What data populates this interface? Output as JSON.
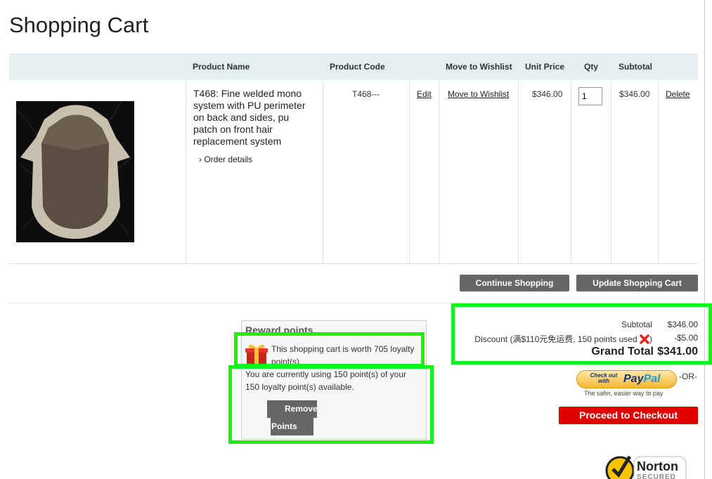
{
  "page": {
    "title": "Shopping Cart"
  },
  "table": {
    "headers": {
      "product_name": "Product Name",
      "product_code": "Product Code",
      "move_to_wishlist": "Move to Wishlist",
      "unit_price": "Unit Price",
      "qty": "Qty",
      "subtotal": "Subtotal"
    },
    "item": {
      "name": "T468: Fine welded mono system with PU perimeter on back and sides, pu patch on front hair replacement system",
      "order_details": "Order details",
      "code": "T468---",
      "edit": "Edit",
      "move_to_wishlist": "Move to Wishlist",
      "unit_price": "$346.00",
      "qty": "1",
      "subtotal": "$346.00",
      "delete": "Delete"
    }
  },
  "actions": {
    "continue_shopping": "Continue Shopping",
    "update_cart": "Update Shopping Cart"
  },
  "reward": {
    "title": "Reward points",
    "worth": "This shopping cart is worth 705 loyalty point(s).",
    "using": "You are currently using 150 point(s) of your 150 loyalty point(s) available.",
    "remove_line1": "Remove",
    "remove_line2": "Points"
  },
  "totals": {
    "subtotal_label": "Subtotal",
    "subtotal_value": "$346.00",
    "discount_label_pre": "Discount (满$110元免运费, 150 points used",
    "discount_label_post": ")",
    "discount_value": "-$5.00",
    "grand_label": "Grand Total",
    "grand_value": "$341.00"
  },
  "checkout": {
    "paypal_small": "Check out with",
    "paypal_brand_a": "Pay",
    "paypal_brand_b": "Pal",
    "or_text": "-OR-",
    "paypal_tagline": "The safer, easier way to pay",
    "proceed": "Proceed to Checkout"
  },
  "badge": {
    "norton": "Norton",
    "secured": "SECURED"
  },
  "colors": {
    "highlight": "#19f019",
    "checkout": "#e00000",
    "header_bg": "#e3eff0",
    "button": "#666666"
  }
}
